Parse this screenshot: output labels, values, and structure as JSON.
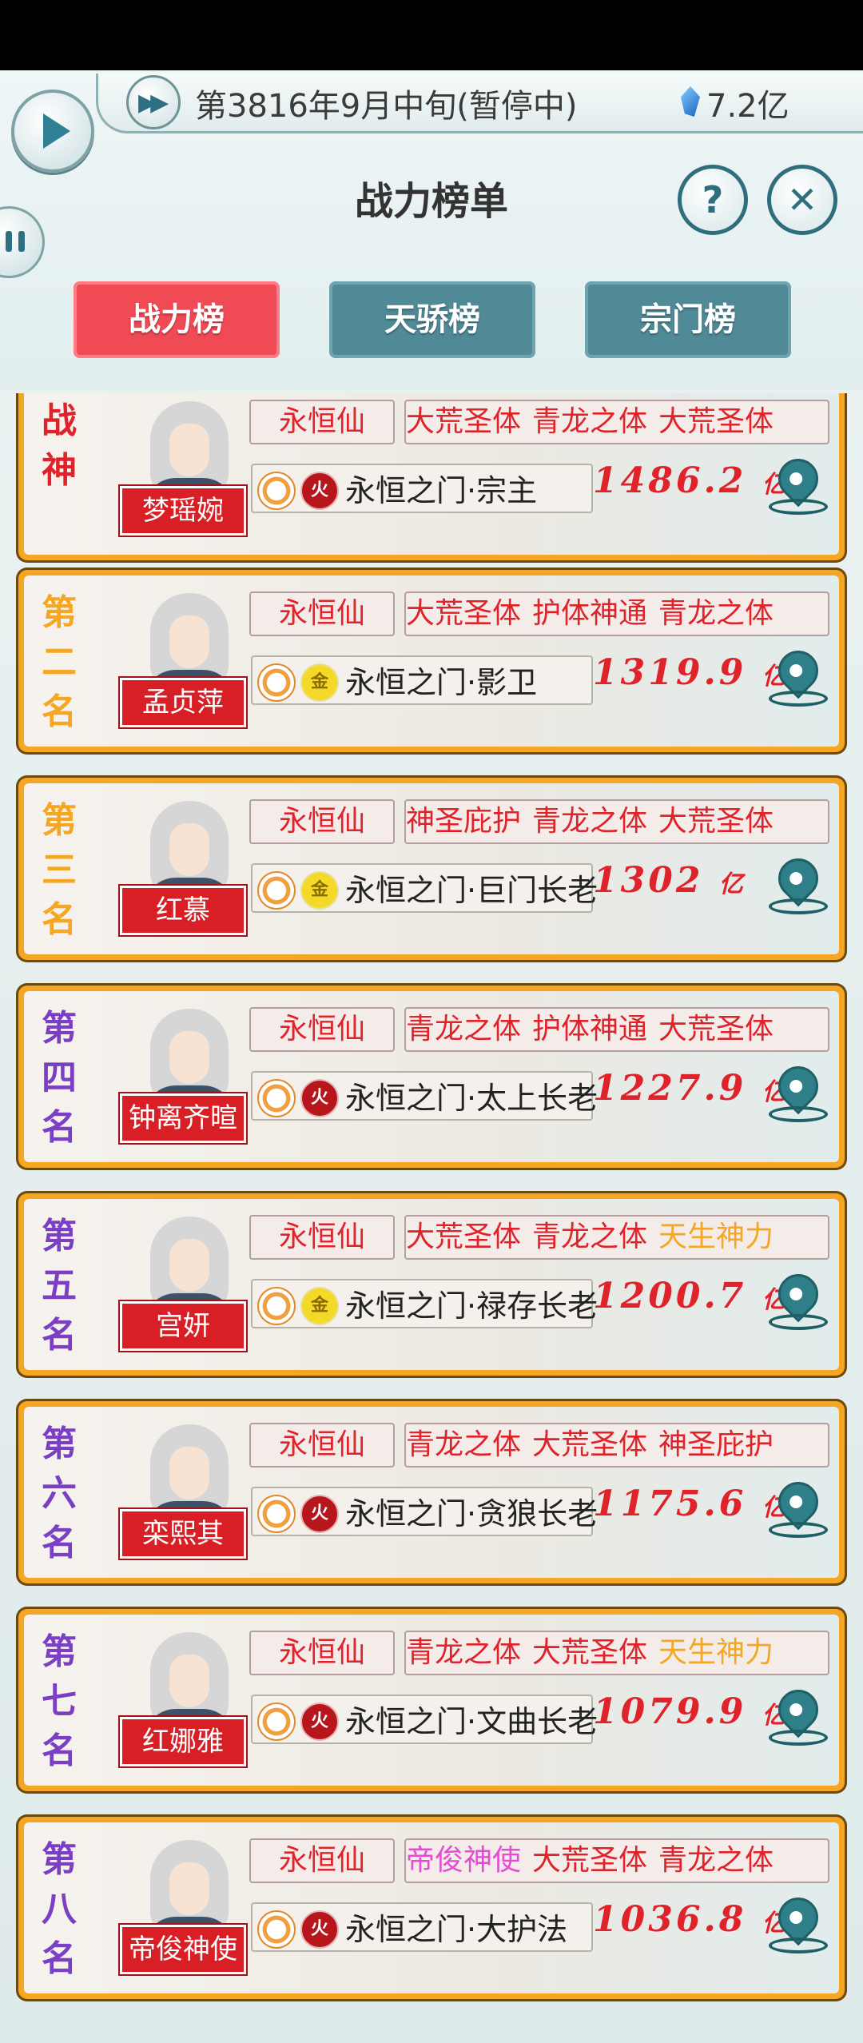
{
  "header": {
    "date_text": "第3816年9月中旬(暂停中)",
    "currency": "7.2亿",
    "title": "战力榜单",
    "help_glyph": "?",
    "close_glyph": "✕"
  },
  "tabs": [
    {
      "label": "战力榜",
      "active": true
    },
    {
      "label": "天骄榜",
      "active": false
    },
    {
      "label": "宗门榜",
      "active": false
    }
  ],
  "ranks": [
    {
      "rank": "战神",
      "name": "梦瑶婉",
      "realm": "永恒仙",
      "traits": [
        "大荒圣体",
        "青龙之体",
        "大荒圣体"
      ],
      "element": "火",
      "sect": "永恒之门·宗主",
      "power": "1486.2",
      "unit": "亿",
      "rank_color": "#e0222b"
    },
    {
      "rank": "第二名",
      "name": "孟贞萍",
      "realm": "永恒仙",
      "traits": [
        "大荒圣体",
        "护体神通",
        "青龙之体"
      ],
      "element": "金",
      "sect": "永恒之门·影卫",
      "power": "1319.9",
      "unit": "亿",
      "rank_color": "#f5a623"
    },
    {
      "rank": "第三名",
      "name": "红慕",
      "realm": "永恒仙",
      "traits": [
        "神圣庇护",
        "青龙之体",
        "大荒圣体"
      ],
      "element": "金",
      "sect": "永恒之门·巨门长老",
      "power": "1302",
      "unit": "亿",
      "rank_color": "#f5a623"
    },
    {
      "rank": "第四名",
      "name": "钟离齐暄",
      "realm": "永恒仙",
      "traits": [
        "青龙之体",
        "护体神通",
        "大荒圣体"
      ],
      "element": "火",
      "sect": "永恒之门·太上长老",
      "power": "1227.9",
      "unit": "亿",
      "rank_color": "#7b3fc4"
    },
    {
      "rank": "第五名",
      "name": "宫妍",
      "realm": "永恒仙",
      "traits": [
        "大荒圣体",
        "青龙之体",
        "天生神力"
      ],
      "element": "金",
      "sect": "永恒之门·禄存长老",
      "power": "1200.7",
      "unit": "亿",
      "rank_color": "#7b3fc4"
    },
    {
      "rank": "第六名",
      "name": "栾熙其",
      "realm": "永恒仙",
      "traits": [
        "青龙之体",
        "大荒圣体",
        "神圣庇护"
      ],
      "element": "火",
      "sect": "永恒之门·贪狼长老",
      "power": "1175.6",
      "unit": "亿",
      "rank_color": "#7b3fc4"
    },
    {
      "rank": "第七名",
      "name": "红娜雅",
      "realm": "永恒仙",
      "traits": [
        "青龙之体",
        "大荒圣体",
        "天生神力"
      ],
      "element": "火",
      "sect": "永恒之门·文曲长老",
      "power": "1079.9",
      "unit": "亿",
      "rank_color": "#7b3fc4"
    },
    {
      "rank": "第八名",
      "name": "帝俊神使",
      "realm": "永恒仙",
      "traits": [
        "帝俊神使",
        "大荒圣体",
        "青龙之体"
      ],
      "element": "火",
      "sect": "永恒之门·大护法",
      "power": "1036.8",
      "unit": "亿",
      "rank_color": "#7b3fc4"
    }
  ],
  "trait_colors": {
    "default": "#e0222b",
    "天生神力": "#f5a623",
    "帝俊神使": "#e54bd6"
  }
}
